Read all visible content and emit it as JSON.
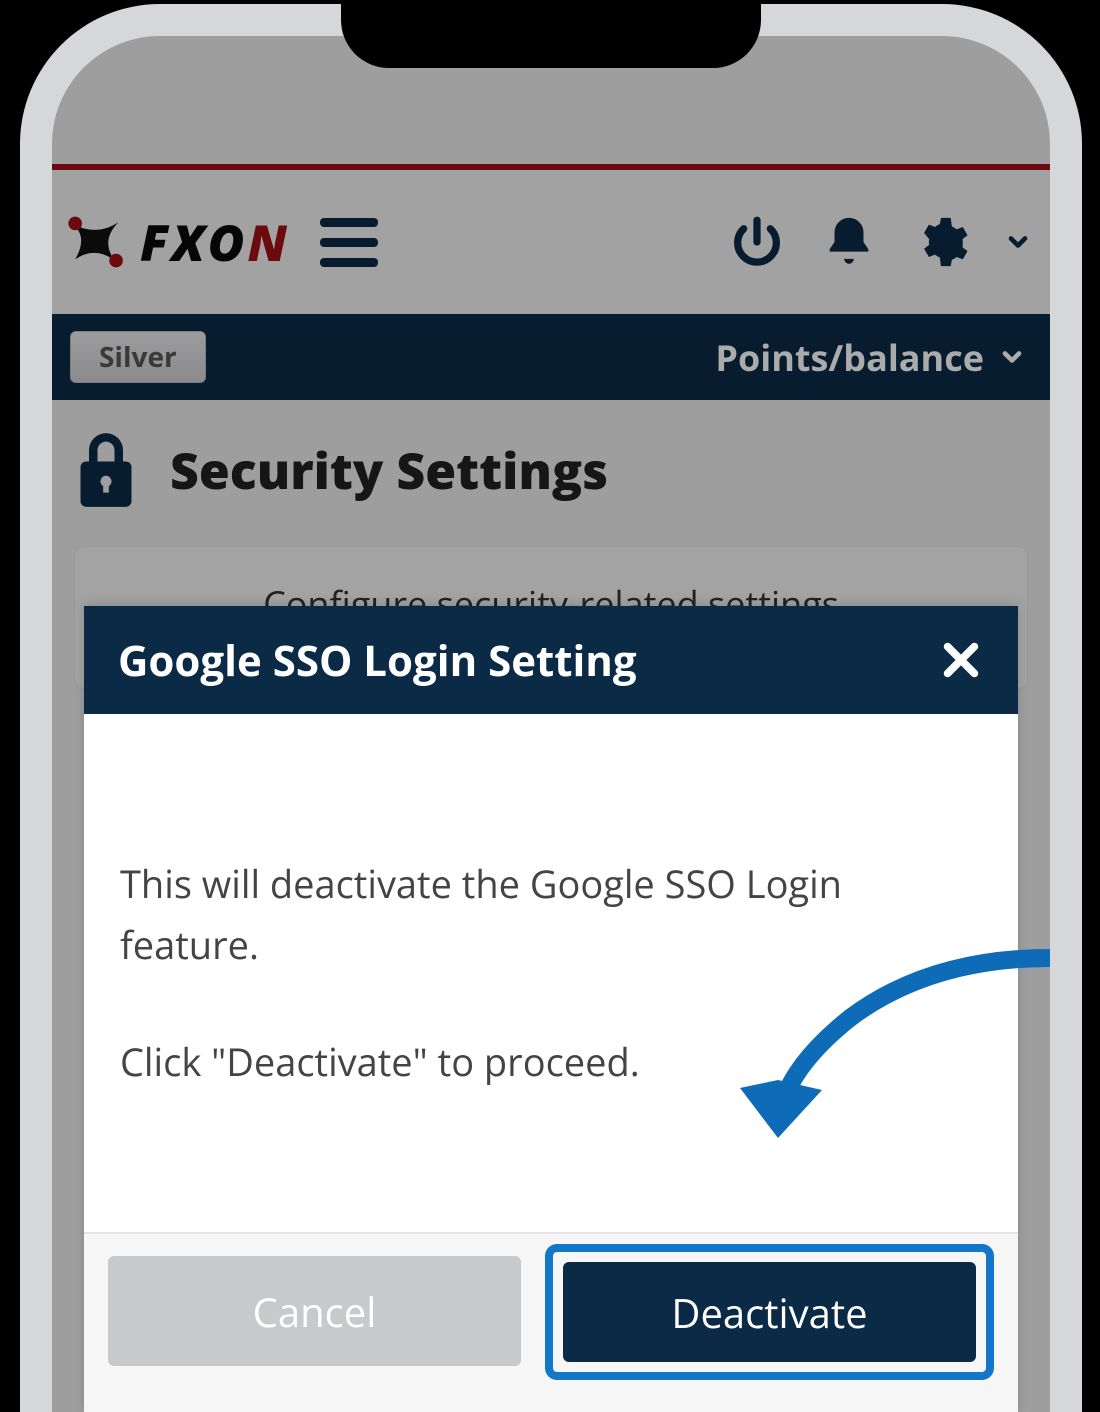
{
  "header": {
    "logo_text_left": "FXO",
    "logo_text_right": "N",
    "icons": {
      "power": "power-icon",
      "bell": "bell-icon",
      "gear": "gear-icon"
    }
  },
  "pointsbar": {
    "tier": "Silver",
    "label": "Points/balance"
  },
  "page": {
    "title": "Security Settings",
    "card_text": "Configure security-related settings"
  },
  "modal": {
    "title": "Google SSO Login Setting",
    "body_line1": "This will deactivate the Google SSO Login feature.",
    "body_line2": "Click \"Deactivate\" to proceed.",
    "cancel_label": "Cancel",
    "deactivate_label": "Deactivate"
  }
}
